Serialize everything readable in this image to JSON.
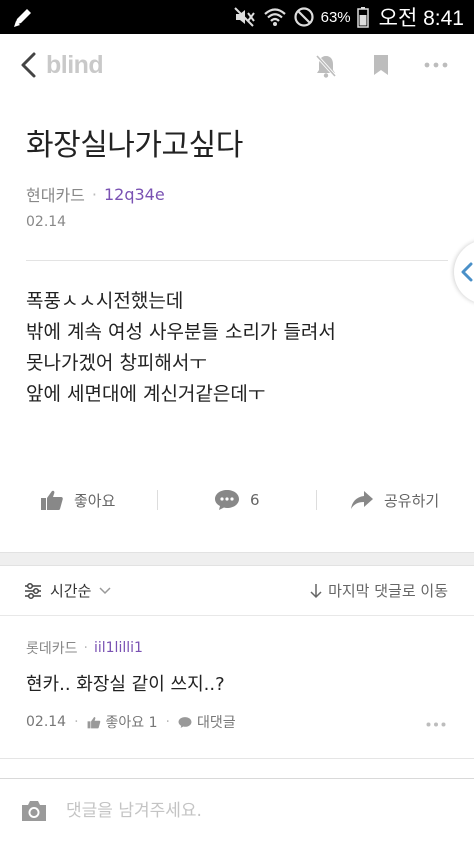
{
  "status_bar": {
    "battery_percent": "63%",
    "time": "오전 8:41",
    "icons": [
      "pen-icon",
      "mute-icon",
      "wifi-icon",
      "blocked-icon",
      "battery-icon"
    ]
  },
  "app_bar": {
    "logo": "blind",
    "icons": [
      "back-arrow-icon",
      "bell-off-icon",
      "bookmark-icon",
      "more-dots-icon"
    ]
  },
  "post": {
    "title": "화장실나가고싶다",
    "company": "현대카드",
    "nickname": "12q34e",
    "date": "02.14",
    "body_lines": [
      "폭풍ㅅㅅ시전했는데",
      "밖에 계속 여성 사우분들 소리가 들려서",
      "못나가겠어 창피해서ㅜ",
      "앞에 세면대에 계신거같은데ㅜ"
    ]
  },
  "actions": {
    "like_label": "좋아요",
    "comment_count": "6",
    "share_label": "공유하기"
  },
  "sort": {
    "label": "시간순",
    "jump_label": "마지막 댓글로 이동"
  },
  "comments": [
    {
      "company": "롯데카드",
      "nickname": "iil1lilli1",
      "text": "현카.. 화장실 같이 쓰지..?",
      "date": "02.14",
      "like_label": "좋아요 1",
      "reply_label": "대댓글"
    }
  ],
  "input": {
    "placeholder": "댓글을 남겨주세요."
  },
  "colors": {
    "accent_purple": "#7a52b3",
    "logo_gray": "#c9c9c9",
    "side_tab_blue": "#4a90c8"
  }
}
